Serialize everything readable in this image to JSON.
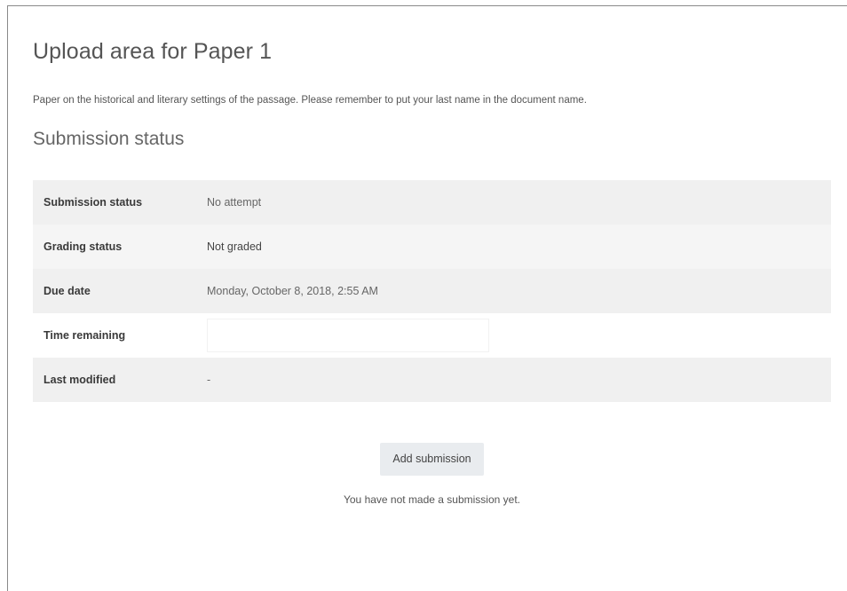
{
  "assignment": {
    "title": "Upload area for Paper 1",
    "description": "Paper on the historical and literary settings of the passage. Please remember to put your last name in the document name."
  },
  "submission": {
    "section_title": "Submission status",
    "rows": [
      {
        "label": "Submission status",
        "value": "No attempt"
      },
      {
        "label": "Grading status",
        "value": "Not graded"
      },
      {
        "label": "Due date",
        "value": "Monday, October 8, 2018, 2:55 AM"
      },
      {
        "label": "Time remaining",
        "value": ""
      },
      {
        "label": "Last modified",
        "value": "-"
      }
    ]
  },
  "actions": {
    "add_submission_label": "Add submission",
    "notice": "You have not made a submission yet."
  }
}
